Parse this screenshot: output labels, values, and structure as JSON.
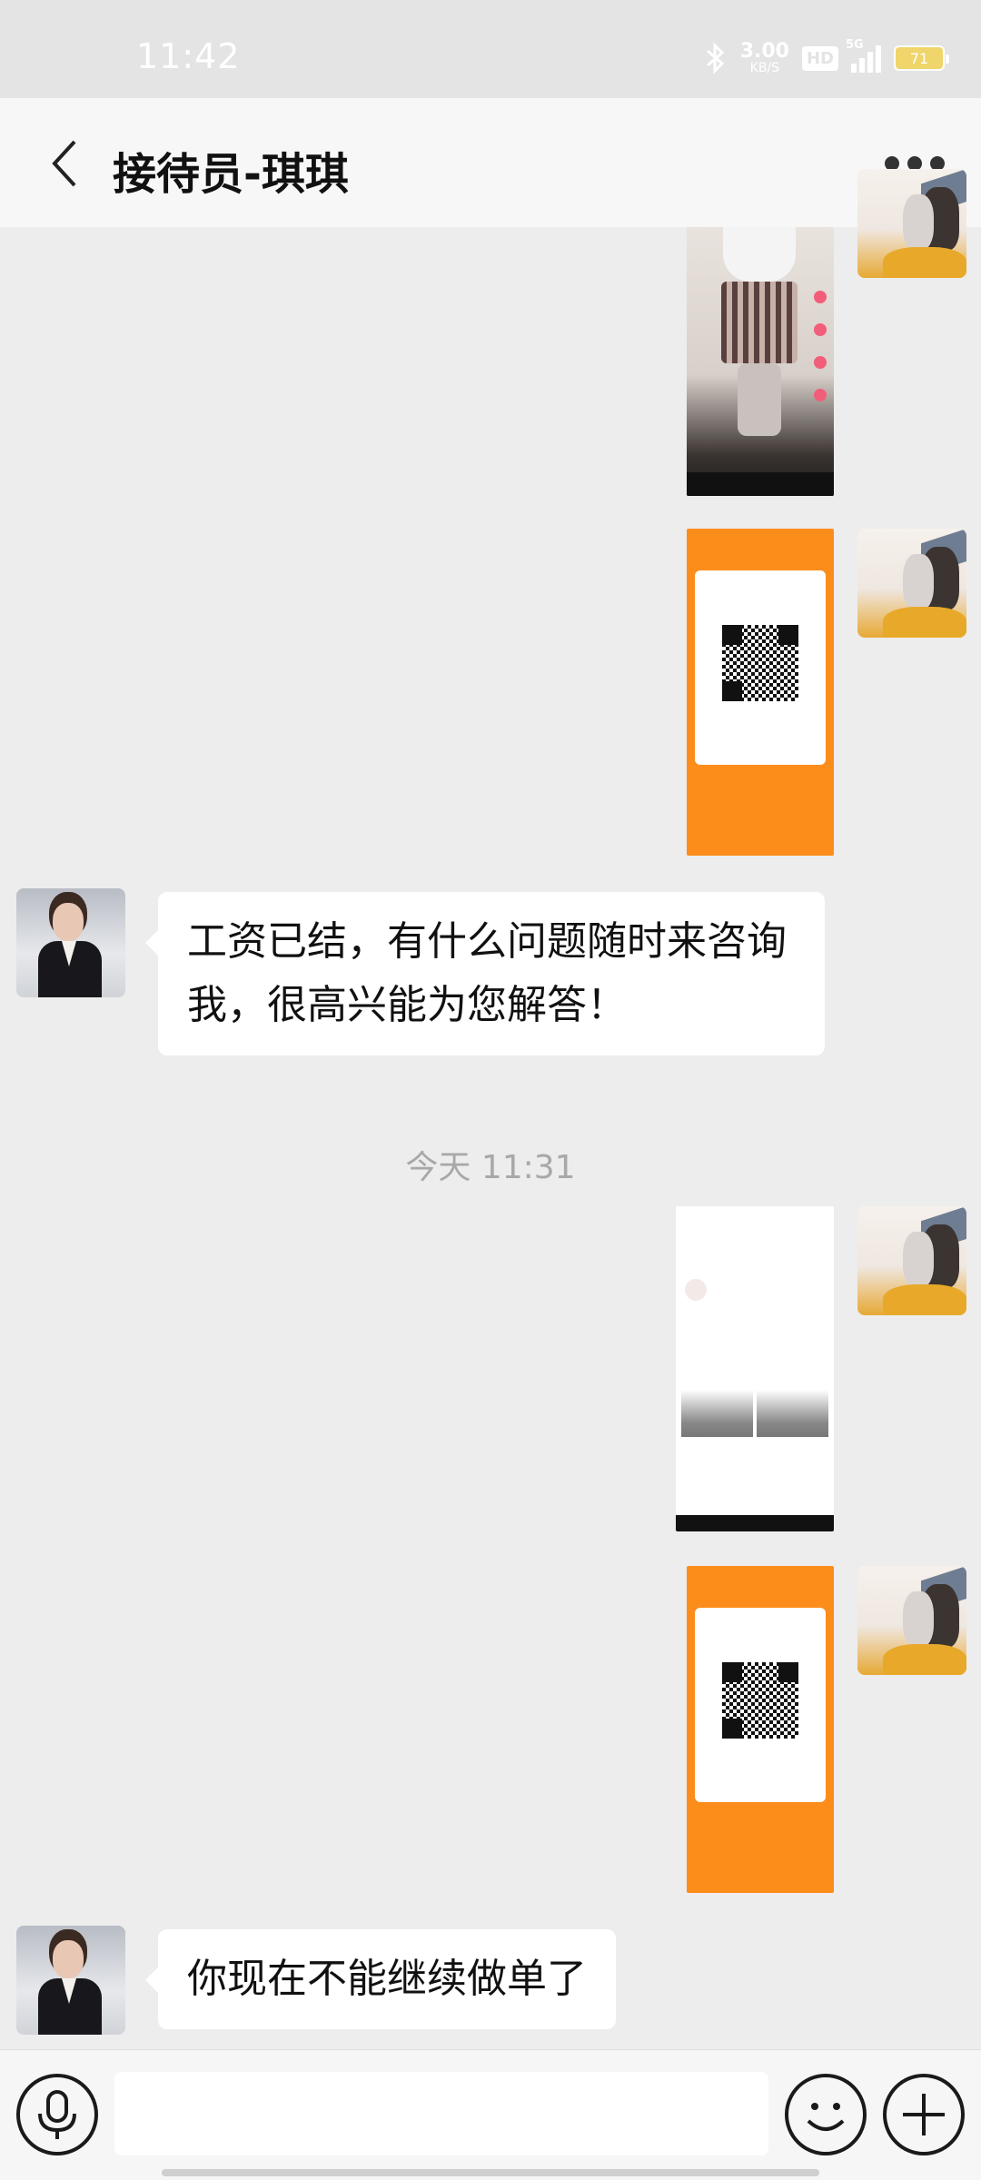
{
  "status_bar": {
    "time": "11:42",
    "net_speed_value": "3.00",
    "net_speed_unit": "KB/S",
    "hd_label": "HD",
    "signal_label": "5G",
    "battery": "71"
  },
  "header": {
    "back_icon": "chevron-left-icon",
    "title": "接待员-琪琪",
    "more_icon": "more-dots-icon"
  },
  "messages": [
    {
      "sender": "me",
      "type": "image",
      "description_icon": "video-screenshot"
    },
    {
      "sender": "me",
      "type": "image",
      "description_icon": "payment-qr-screenshot"
    },
    {
      "sender": "agent",
      "type": "text",
      "text": "工资已结，有什么问题随时来咨询我，很高兴能为您解答！"
    },
    {
      "sender": "me",
      "type": "image",
      "description_icon": "search-result-screenshot"
    },
    {
      "sender": "me",
      "type": "image",
      "description_icon": "payment-qr-screenshot"
    },
    {
      "sender": "agent",
      "type": "text",
      "text": "你现在不能继续做单了"
    }
  ],
  "timestamp": "今天 11:31",
  "input_bar": {
    "voice_icon": "microphone-icon",
    "input_value": "",
    "emoji_icon": "emoji-smile-icon",
    "plus_icon": "plus-icon"
  },
  "colors": {
    "background": "#ededed",
    "header": "#f7f7f7",
    "bubble": "#ffffff",
    "qr_orange": "#fd8d1b"
  }
}
